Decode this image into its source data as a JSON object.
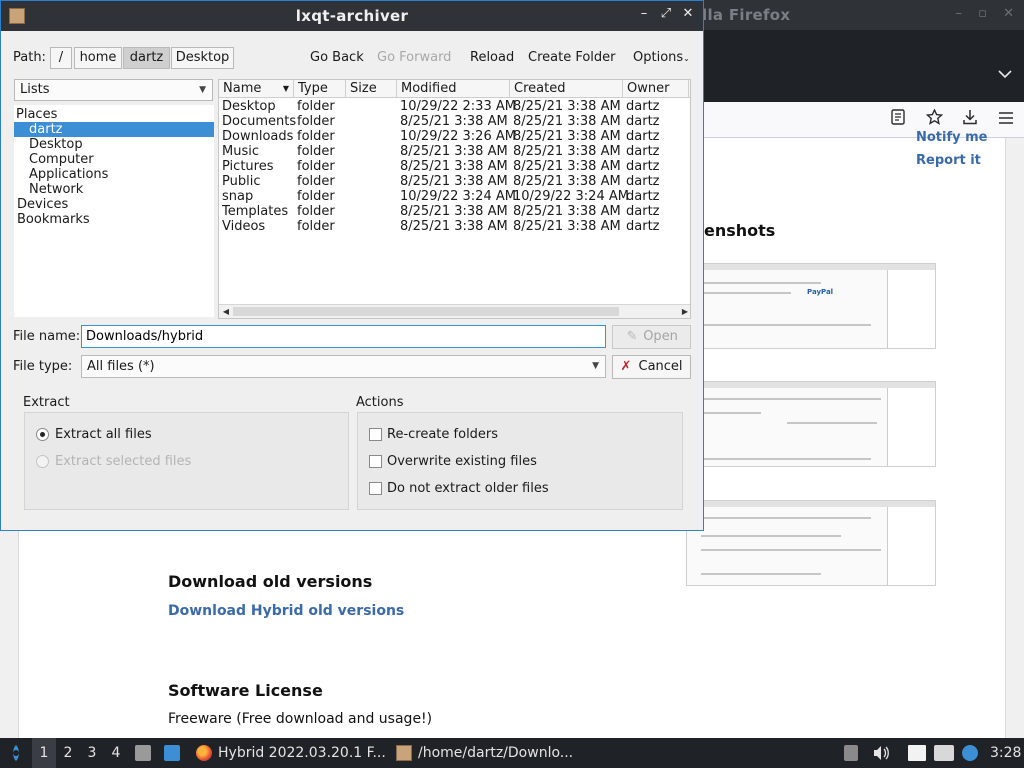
{
  "background_firefox": {
    "title": "lla Firefox",
    "notify_link": "Notify me",
    "report_link": "Report it",
    "screenshots_heading": "enshots",
    "download_old_heading": "Download old versions",
    "download_old_link": "Download Hybrid old versions",
    "license_heading": "Software License",
    "license_text": "Freeware (Free download and usage!)",
    "thumb_label": "PayPal"
  },
  "dialog": {
    "title": "lxqt-archiver",
    "path_label": "Path:",
    "path_segments": [
      "/",
      "home",
      "dartz",
      "Desktop"
    ],
    "active_segment": "dartz",
    "toolbar": {
      "go_back": "Go Back",
      "go_forward": "Go Forward",
      "reload": "Reload",
      "create_folder": "Create Folder",
      "options": "Options"
    },
    "lists_combo": "Lists",
    "places": [
      {
        "label": "Places",
        "indent": 0,
        "selected": false
      },
      {
        "label": "dartz",
        "indent": 1,
        "selected": true
      },
      {
        "label": "Desktop",
        "indent": 1,
        "selected": false
      },
      {
        "label": "Computer",
        "indent": 1,
        "selected": false
      },
      {
        "label": "Applications",
        "indent": 1,
        "selected": false
      },
      {
        "label": "Network",
        "indent": 1,
        "selected": false
      },
      {
        "label": "Devices",
        "indent": 0,
        "selected": false
      },
      {
        "label": "Bookmarks",
        "indent": 0,
        "selected": false
      }
    ],
    "columns": [
      "Name",
      "Type",
      "Size",
      "Modified",
      "Created",
      "Owner"
    ],
    "files": [
      {
        "name": "Desktop",
        "type": "folder",
        "size": "",
        "modified": "10/29/22 2:33 AM",
        "created": "8/25/21 3:38 AM",
        "owner": "dartz"
      },
      {
        "name": "Documents",
        "type": "folder",
        "size": "",
        "modified": "8/25/21 3:38 AM",
        "created": "8/25/21 3:38 AM",
        "owner": "dartz"
      },
      {
        "name": "Downloads",
        "type": "folder",
        "size": "",
        "modified": "10/29/22 3:26 AM",
        "created": "8/25/21 3:38 AM",
        "owner": "dartz"
      },
      {
        "name": "Music",
        "type": "folder",
        "size": "",
        "modified": "8/25/21 3:38 AM",
        "created": "8/25/21 3:38 AM",
        "owner": "dartz"
      },
      {
        "name": "Pictures",
        "type": "folder",
        "size": "",
        "modified": "8/25/21 3:38 AM",
        "created": "8/25/21 3:38 AM",
        "owner": "dartz"
      },
      {
        "name": "Public",
        "type": "folder",
        "size": "",
        "modified": "8/25/21 3:38 AM",
        "created": "8/25/21 3:38 AM",
        "owner": "dartz"
      },
      {
        "name": "snap",
        "type": "folder",
        "size": "",
        "modified": "10/29/22 3:24 AM",
        "created": "10/29/22 3:24 AM",
        "owner": "dartz"
      },
      {
        "name": "Templates",
        "type": "folder",
        "size": "",
        "modified": "8/25/21 3:38 AM",
        "created": "8/25/21 3:38 AM",
        "owner": "dartz"
      },
      {
        "name": "Videos",
        "type": "folder",
        "size": "",
        "modified": "8/25/21 3:38 AM",
        "created": "8/25/21 3:38 AM",
        "owner": "dartz"
      }
    ],
    "file_name_label": "File name:",
    "file_name_value": "Downloads/hybrid",
    "open_button": "Open",
    "file_type_label": "File type:",
    "file_type_value": "All files (*)",
    "cancel_button": "Cancel",
    "extract_group": {
      "title": "Extract",
      "options": [
        {
          "label": "Extract all files",
          "checked": true,
          "enabled": true
        },
        {
          "label": "Extract selected files",
          "checked": false,
          "enabled": false
        }
      ]
    },
    "actions_group": {
      "title": "Actions",
      "options": [
        {
          "label": "Re-create folders",
          "checked": false
        },
        {
          "label": "Overwrite existing files",
          "checked": false
        },
        {
          "label": "Do not extract older files",
          "checked": false
        }
      ]
    }
  },
  "taskbar": {
    "desktops": [
      "1",
      "2",
      "3",
      "4"
    ],
    "active_desktop": "1",
    "tasks": [
      {
        "label": "Hybrid 2022.03.20.1 F...",
        "icon": "firefox-icon"
      },
      {
        "label": "/home/dartz/Downlo...",
        "icon": "archiver-icon"
      }
    ],
    "clock": "3:28"
  },
  "colors": {
    "accent": "#3c8fd4",
    "titlebar": "#2f3338",
    "taskbar": "#1f2226",
    "link": "#3a6aa8"
  }
}
